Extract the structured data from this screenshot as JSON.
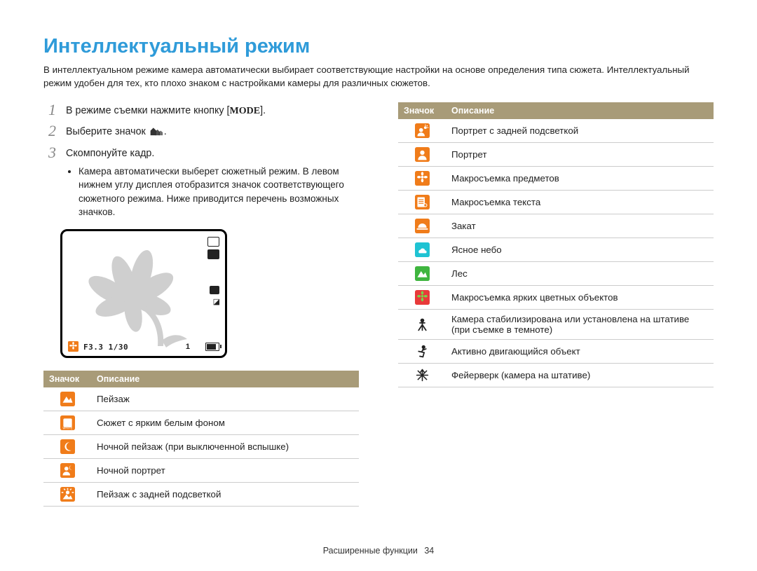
{
  "title": "Интеллектуальный режим",
  "intro": "В интеллектуальном режиме камера автоматически выбирает соответствующие настройки на основе определения типа сюжета. Интеллектуальный режим удобен для тех, кто плохо знаком с настройками камеры для различных сюжетов.",
  "steps": {
    "1": {
      "text_before": "В режиме съемки нажмите кнопку [",
      "mode_label": "MODE",
      "text_after": "]."
    },
    "2": {
      "text_before": "Выберите значок ",
      "text_after": "."
    },
    "3": {
      "text": "Скомпонуйте кадр.",
      "bullet": "Камера автоматически выберет сюжетный режим. В левом нижнем углу дисплея отобразится значок соответствующего сюжетного режима. Ниже приводится перечень возможных значков."
    }
  },
  "frame": {
    "exposure": "F3.3  1/30",
    "remaining": "1"
  },
  "table_headers": {
    "icon": "Значок",
    "desc": "Описание"
  },
  "table_left": [
    {
      "id": "landscape",
      "desc": "Пейзаж"
    },
    {
      "id": "white-bg",
      "desc": "Сюжет с ярким белым фоном"
    },
    {
      "id": "night-landscape",
      "desc": "Ночной пейзаж (при выключенной вспышке)"
    },
    {
      "id": "night-portrait",
      "desc": "Ночной портрет"
    },
    {
      "id": "backlit-landscape",
      "desc": "Пейзаж с задней подсветкой"
    }
  ],
  "table_right": [
    {
      "id": "backlit-portrait",
      "desc": "Портрет с задней подсветкой"
    },
    {
      "id": "portrait",
      "desc": "Портрет"
    },
    {
      "id": "macro-object",
      "desc": "Макросъемка предметов"
    },
    {
      "id": "macro-text",
      "desc": "Макросъемка текста"
    },
    {
      "id": "sunset",
      "desc": "Закат"
    },
    {
      "id": "clear-sky",
      "desc": "Ясное небо"
    },
    {
      "id": "forest",
      "desc": "Лес"
    },
    {
      "id": "macro-color",
      "desc": "Макросъемка ярких цветных объектов"
    },
    {
      "id": "tripod",
      "desc": "Камера стабилизирована или установлена на штативе (при съемке в темноте)"
    },
    {
      "id": "action",
      "desc": "Активно двигающийся объект"
    },
    {
      "id": "fireworks",
      "desc": "Фейерверк (камера на штативе)"
    }
  ],
  "footer": {
    "section": "Расширенные функции",
    "page": "34"
  }
}
